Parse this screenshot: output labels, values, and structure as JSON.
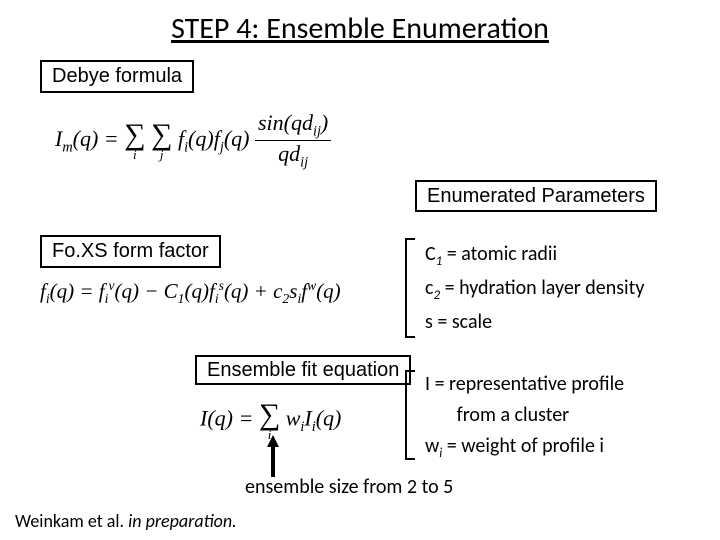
{
  "title": "STEP 4: Ensemble Enumeration",
  "boxes": {
    "debye": "Debye formula",
    "foxs": "Fo.XS form factor",
    "enum": "Enumerated Parameters",
    "ensemble": "Ensemble fit equation"
  },
  "formulas": {
    "debye_lhs": "I",
    "debye_lhs_sub": "m",
    "debye_arg": "(q) =",
    "sigma_i": "i",
    "sigma_j": "j",
    "debye_fi": "f",
    "debye_fi_sub": "i",
    "debye_fi_arg": "(q)",
    "debye_fj": "f",
    "debye_fj_sub": "j",
    "debye_fj_arg": "(q)",
    "debye_num": "sin(qd",
    "debye_num_sub": "ij",
    "debye_num_close": ")",
    "debye_den": "qd",
    "debye_den_sub": "ij",
    "foxs_lhs": "f",
    "foxs_lhs_sub": "i",
    "foxs_arg": "(q) = f",
    "foxs_v_sub": "i",
    "foxs_v_sup": "v",
    "foxs_v_arg": "(q) − C",
    "foxs_c1_sub": "1",
    "foxs_c1_arg": "(q)f",
    "foxs_s_sub": "i",
    "foxs_s_sup": "s",
    "foxs_s_arg": "(q) + c",
    "foxs_c2_sub": "2",
    "foxs_si": "s",
    "foxs_si_sub": "i",
    "foxs_fw": "f",
    "foxs_fw_sup": "w",
    "foxs_fw_arg": "(q)",
    "ens_lhs": "I(q) =",
    "ens_wi": "w",
    "ens_wi_sub": "i",
    "ens_Ii": "I",
    "ens_Ii_sub": "i",
    "ens_Ii_arg": "(q)"
  },
  "params1": {
    "c1_sym": "C",
    "c1_sub": "1",
    "c1_text": " = atomic radii",
    "c2_sym": "c",
    "c2_sub": "2",
    "c2_text": " = hydration layer density",
    "s_sym": "s  ",
    "s_text": " = scale"
  },
  "params2": {
    "I_sym": "I",
    "I_text": "   = representative profile",
    "I_text2": "       from a cluster",
    "w_sym": "w",
    "w_sub": "i",
    "w_text": " = weight of profile i"
  },
  "caption": "ensemble size from 2 to 5",
  "citation_a": "Weinkam et al. ",
  "citation_b": "in preparation."
}
